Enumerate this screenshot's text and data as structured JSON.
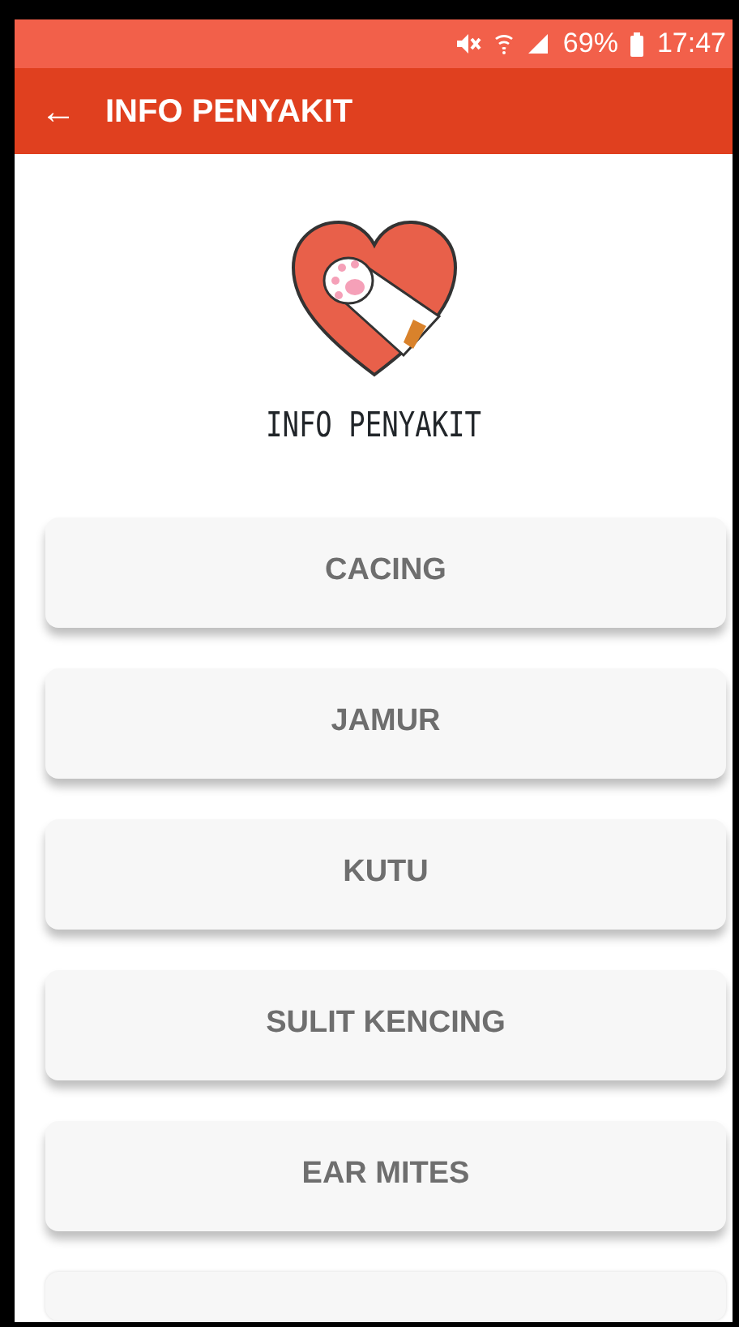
{
  "status_bar": {
    "battery": "69%",
    "time": "17:47"
  },
  "app_bar": {
    "back": "←",
    "title": "INFO PENYAKIT"
  },
  "logo": {
    "caption": "INFO PENYAKIT"
  },
  "menu": [
    {
      "label": "CACING"
    },
    {
      "label": "JAMUR"
    },
    {
      "label": "KUTU"
    },
    {
      "label": "SULIT KENCING"
    },
    {
      "label": "EAR MITES"
    }
  ]
}
